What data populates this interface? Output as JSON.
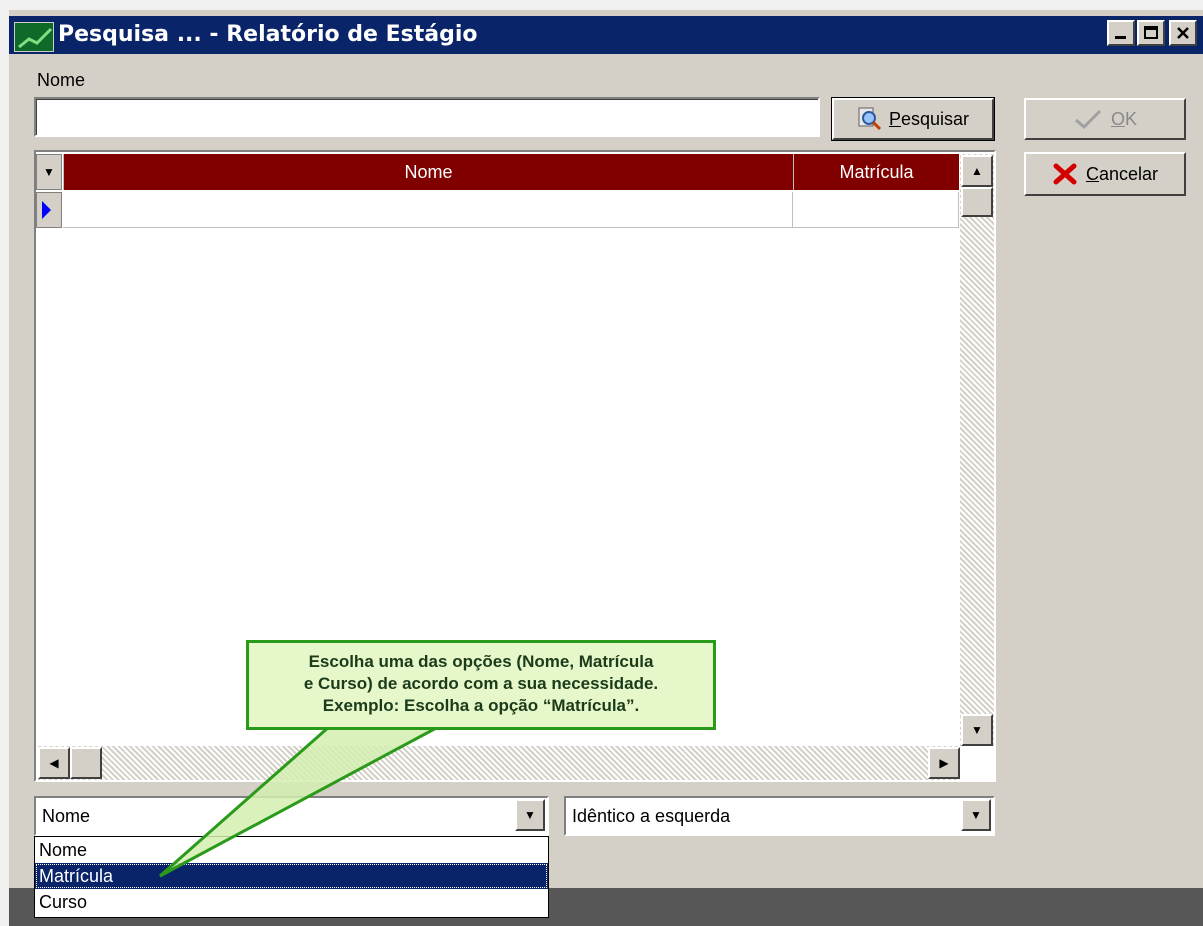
{
  "window": {
    "title": "Pesquisa ... - Relatório de Estágio",
    "controls": {
      "minimize": "_",
      "maximize": "□",
      "close": "✕"
    }
  },
  "search": {
    "label": "Nome",
    "value": "",
    "button_first_letter": "P",
    "button_rest": "esquisar"
  },
  "actions": {
    "ok_first_letter": "O",
    "ok_rest": "K",
    "cancel_first_letter": "C",
    "cancel_rest": "ancelar"
  },
  "grid": {
    "columns": [
      "Nome",
      "Matrícula"
    ],
    "rows": [
      [
        "",
        ""
      ]
    ]
  },
  "filters": {
    "field_selected": "Nome",
    "match_mode": "Idêntico a esquerda",
    "field_options": [
      "Nome",
      "Matrícula",
      "Curso"
    ],
    "highlighted_option": "Matrícula"
  },
  "callout": {
    "line1": "Escolha uma das opções (Nome, Matrícula",
    "line2": "e Curso) de acordo com a sua necessidade.",
    "line3": "Exemplo: Escolha a opção “Matrícula”."
  },
  "colors": {
    "title_bar": "#0a246a",
    "grid_header": "#800000",
    "callout_fill": "#e6f7c9",
    "callout_border": "#2a9a1a",
    "selection": "#0a246a"
  },
  "icons": {
    "search": "magnifier-icon",
    "ok": "checkmark-icon",
    "cancel": "red-x-icon",
    "app": "chart-icon"
  }
}
